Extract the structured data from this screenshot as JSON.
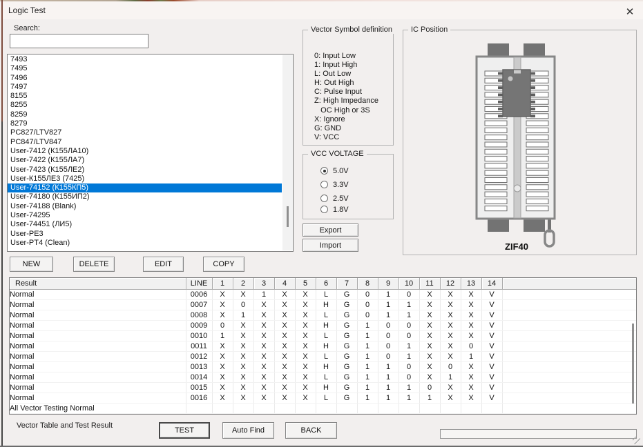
{
  "window": {
    "title": "Logic Test",
    "close_glyph": "✕"
  },
  "search": {
    "label": "Search:",
    "value": ""
  },
  "chip_list": {
    "items": [
      "7493",
      "7495",
      "7496",
      "7497",
      "8155",
      "8255",
      "8259",
      "8279",
      "PC827/LTV827",
      "PC847/LTV847",
      "User-7412 (К155ЛА10)",
      "User-7422 (К155ЛА7)",
      "User-7423 (К155ЛЕ2)",
      "User-К155ЛЕ3 (7425)",
      "User-74152 (К155КП5)",
      "User-74180 (К155ИП2)",
      "User-74188 (Blank)",
      "User-74295",
      "User-74451 (ЛИ5)",
      "User-PE3",
      "User-PT4 (Clean)"
    ],
    "selected_index": 14,
    "selected_item": "User-74152 (К155КП5)"
  },
  "list_buttons": [
    "NEW",
    "DELETE",
    "EDIT",
    "COPY"
  ],
  "vector_symbols": {
    "title": "Vector Symbol definition",
    "lines": [
      "0: Input Low",
      "1: Input High",
      "L: Out Low",
      "H: Out High",
      "C: Pulse Input",
      "Z: High Impedance",
      "   OC High or 3S",
      "X: Ignore",
      "G: GND",
      "V: VCC"
    ]
  },
  "vcc": {
    "title": "VCC VOLTAGE",
    "options": [
      "5.0V",
      "3.3V",
      "2.5V",
      "1.8V"
    ],
    "selected": "5.0V"
  },
  "io_buttons": {
    "export": "Export",
    "import": "Import"
  },
  "ic_position": {
    "title": "IC Position",
    "socket_label": "ZIF40"
  },
  "vector_table": {
    "headers": [
      "Result",
      "LINE",
      "1",
      "2",
      "3",
      "4",
      "5",
      "6",
      "7",
      "8",
      "9",
      "10",
      "11",
      "12",
      "13",
      "14",
      ""
    ],
    "rows": [
      {
        "result": "Normal",
        "line": "0006",
        "values": [
          "X",
          "X",
          "1",
          "X",
          "X",
          "L",
          "G",
          "0",
          "1",
          "0",
          "X",
          "X",
          "X",
          "V"
        ]
      },
      {
        "result": "Normal",
        "line": "0007",
        "values": [
          "X",
          "0",
          "X",
          "X",
          "X",
          "H",
          "G",
          "0",
          "1",
          "1",
          "X",
          "X",
          "X",
          "V"
        ]
      },
      {
        "result": "Normal",
        "line": "0008",
        "values": [
          "X",
          "1",
          "X",
          "X",
          "X",
          "L",
          "G",
          "0",
          "1",
          "1",
          "X",
          "X",
          "X",
          "V"
        ]
      },
      {
        "result": "Normal",
        "line": "0009",
        "values": [
          "0",
          "X",
          "X",
          "X",
          "X",
          "H",
          "G",
          "1",
          "0",
          "0",
          "X",
          "X",
          "X",
          "V"
        ]
      },
      {
        "result": "Normal",
        "line": "0010",
        "values": [
          "1",
          "X",
          "X",
          "X",
          "X",
          "L",
          "G",
          "1",
          "0",
          "0",
          "X",
          "X",
          "X",
          "V"
        ]
      },
      {
        "result": "Normal",
        "line": "0011",
        "values": [
          "X",
          "X",
          "X",
          "X",
          "X",
          "H",
          "G",
          "1",
          "0",
          "1",
          "X",
          "X",
          "0",
          "V"
        ]
      },
      {
        "result": "Normal",
        "line": "0012",
        "values": [
          "X",
          "X",
          "X",
          "X",
          "X",
          "L",
          "G",
          "1",
          "0",
          "1",
          "X",
          "X",
          "1",
          "V"
        ]
      },
      {
        "result": "Normal",
        "line": "0013",
        "values": [
          "X",
          "X",
          "X",
          "X",
          "X",
          "H",
          "G",
          "1",
          "1",
          "0",
          "X",
          "0",
          "X",
          "V"
        ]
      },
      {
        "result": "Normal",
        "line": "0014",
        "values": [
          "X",
          "X",
          "X",
          "X",
          "X",
          "L",
          "G",
          "1",
          "1",
          "0",
          "X",
          "1",
          "X",
          "V"
        ]
      },
      {
        "result": "Normal",
        "line": "0015",
        "values": [
          "X",
          "X",
          "X",
          "X",
          "X",
          "H",
          "G",
          "1",
          "1",
          "1",
          "0",
          "X",
          "X",
          "V"
        ]
      },
      {
        "result": "Normal",
        "line": "0016",
        "values": [
          "X",
          "X",
          "X",
          "X",
          "X",
          "L",
          "G",
          "1",
          "1",
          "1",
          "1",
          "X",
          "X",
          "V"
        ]
      }
    ],
    "footer": "All Vector Testing Normal"
  },
  "bottom": {
    "label": "Vector Table and Test Result",
    "buttons": [
      "TEST",
      "Auto Find",
      "BACK"
    ]
  },
  "colors": {
    "selection_bg": "#0078d7",
    "selection_text": "#ffffff",
    "socket_gray": "#737373"
  }
}
